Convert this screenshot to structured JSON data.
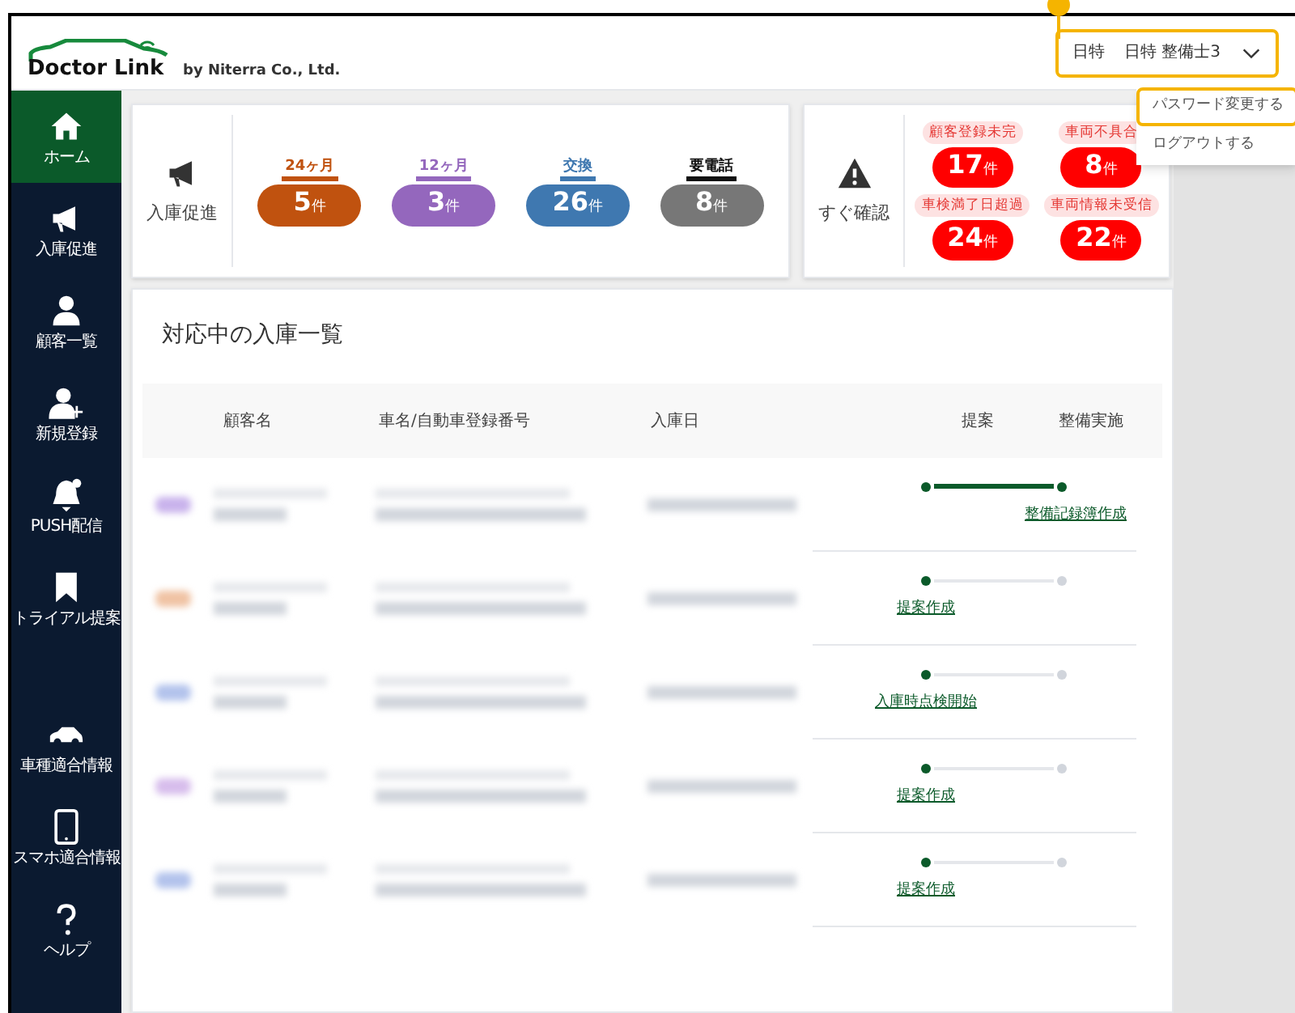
{
  "header": {
    "logo": {
      "brand": "Doctor Link",
      "by": "by Niterra Co., Ltd."
    },
    "user_menu": {
      "shop": "日特",
      "user": "日特 整備士3",
      "highlighted": true,
      "items": [
        {
          "label": "パスワード変更する",
          "highlighted": true
        },
        {
          "label": "ログアウトする",
          "highlighted": false
        }
      ]
    }
  },
  "sidebar": {
    "items": [
      {
        "label": "ホーム",
        "selected": true
      },
      {
        "label": "入庫促進",
        "selected": false
      },
      {
        "label": "顧客一覧",
        "selected": false
      },
      {
        "label": "新規登録",
        "selected": false
      },
      {
        "label": "PUSH配信",
        "selected": false
      },
      {
        "label": "トライアル提案",
        "selected": false
      },
      {
        "label": "車種適合情報",
        "selected": false
      },
      {
        "label": "スマホ適合情報",
        "selected": false
      },
      {
        "label": "ヘルプ",
        "selected": false
      }
    ]
  },
  "promotion_card": {
    "title": "入庫促進",
    "counts": [
      {
        "label": "24ヶ月",
        "value": "5",
        "unit": "件",
        "color": "#c0520f"
      },
      {
        "label": "12ヶ月",
        "value": "3",
        "unit": "件",
        "color": "#9467bd"
      },
      {
        "label": "交換",
        "value": "26",
        "unit": "件",
        "color": "#3f78b0"
      },
      {
        "label": "要電話",
        "value": "8",
        "unit": "件",
        "color": "#777777"
      }
    ]
  },
  "check_card": {
    "title": "すぐ確認",
    "counts": [
      {
        "label": "顧客登録未完",
        "value": "17",
        "unit": "件"
      },
      {
        "label": "車両不具合",
        "value": "8",
        "unit": "件"
      },
      {
        "label": "車検満了日超過",
        "value": "24",
        "unit": "件"
      },
      {
        "label": "車両情報未受信",
        "value": "22",
        "unit": "件"
      }
    ]
  },
  "table": {
    "title": "対応中の入庫一覧",
    "columns": [
      "顧客名",
      "車名/自動車登録番号",
      "入庫日",
      "提案",
      "整備実施"
    ],
    "rows": [
      {
        "color": "#c9b3ec",
        "maintenance_reached": true,
        "action": "整備記録簿作成"
      },
      {
        "color": "#f0c3a4",
        "maintenance_reached": false,
        "action": "提案作成"
      },
      {
        "color": "#b3c3ec",
        "maintenance_reached": false,
        "action": "入庫時点検開始"
      },
      {
        "color": "#d7bdec",
        "maintenance_reached": false,
        "action": "提案作成"
      },
      {
        "color": "#b3c3ec",
        "maintenance_reached": false,
        "action": "提案作成"
      }
    ]
  }
}
